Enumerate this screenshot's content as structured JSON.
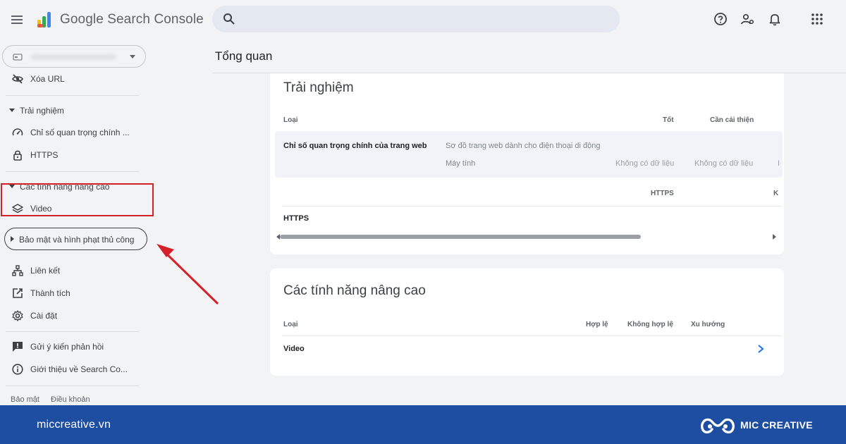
{
  "header": {
    "app_title": "Google Search Console",
    "search_placeholder": ""
  },
  "sidebar": {
    "remove_url": "Xóa URL",
    "experience_section": "Trải nghiệm",
    "cwv": "Chỉ số quan trọng chính ...",
    "https": "HTTPS",
    "enhancements_section": "Các tính năng nâng cao",
    "video": "Video",
    "security_section": "Bảo mật và hình phạt thủ công",
    "links": "Liên kết",
    "achievements": "Thành tích",
    "settings": "Cài đặt",
    "feedback": "Gửi ý kiến phản hồi",
    "about": "Giới thiệu về Search Co...",
    "privacy": "Bảo mật",
    "terms": "Điều khoản"
  },
  "main": {
    "page_title": "Tổng quan",
    "experience_card": {
      "title": "Trải nghiệm",
      "col_type": "Loại",
      "col_good": "Tốt",
      "col_needs_improvement": "Cần cải thiện",
      "row_cwv_label": "Chỉ số quan trọng chính của trang web",
      "row_mobile_label": "Sơ đồ trang web dành cho điện thoại di động",
      "row_desktop_label": "Máy tính",
      "no_data_1": "Không có dữ liệu",
      "no_data_2": "Không có dữ liệu",
      "no_data_3_partial": "I",
      "sub_col_https": "HTTPS",
      "sub_col_partial": "K",
      "row_https_label": "HTTPS"
    },
    "enhancements_card": {
      "title": "Các tính năng nâng cao",
      "col_type": "Loại",
      "col_valid": "Hợp lệ",
      "col_invalid": "Không hợp lệ",
      "col_trend": "Xu hướng",
      "row_video_label": "Video"
    }
  },
  "footer": {
    "url": "miccreative.vn",
    "brand": "MIC CREATIVE"
  },
  "colors": {
    "highlight_box": "#d3202a",
    "footer_bg": "#1e4ea2",
    "link_blue": "#1a73e8"
  }
}
